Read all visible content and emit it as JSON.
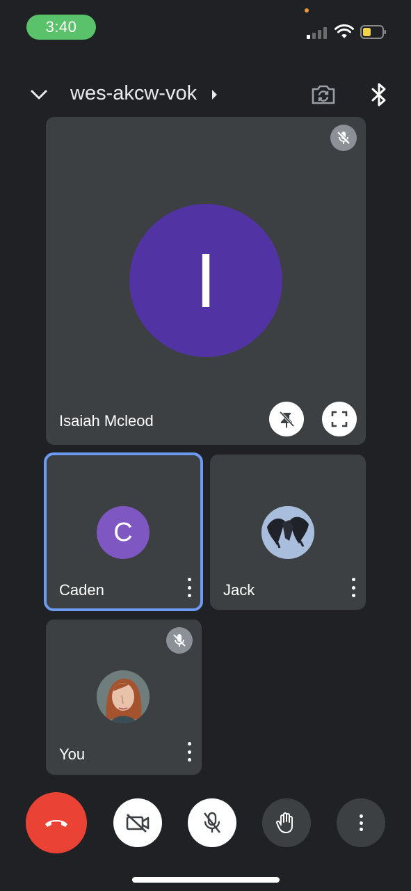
{
  "status_bar": {
    "time": "3:40",
    "signal_bars_active": 1,
    "battery_level_fraction": 0.35,
    "colors": {
      "time_pill": "#5ac26a",
      "battery": "#f3d34a",
      "privacy_dot": "#f0983a"
    }
  },
  "header": {
    "meeting_code": "wes-akcw-vok",
    "icons": [
      "chevron-down-icon",
      "caret-right-icon",
      "switch-camera-icon",
      "bluetooth-icon"
    ]
  },
  "participants": {
    "featured": {
      "name": "Isaiah Mcleod",
      "initial": "I",
      "avatar_color": "#5133a4",
      "muted": true,
      "actions": [
        "unpin-icon",
        "fullscreen-icon"
      ]
    },
    "tiles": [
      {
        "name": "Caden",
        "initial": "C",
        "avatar_color": "#7e57c2",
        "active_speaker": true,
        "muted": false
      },
      {
        "name": "Jack",
        "avatar": "crow-image",
        "muted": false
      },
      {
        "name": "You",
        "avatar": "portrait-image",
        "muted": true
      }
    ]
  },
  "controls": {
    "items": [
      {
        "name": "end-call",
        "icon": "phone-hangup-icon",
        "color": "#ea4335"
      },
      {
        "name": "camera",
        "icon": "video-off-icon"
      },
      {
        "name": "microphone",
        "icon": "mic-off-icon"
      },
      {
        "name": "raise-hand",
        "icon": "hand-icon"
      },
      {
        "name": "more",
        "icon": "more-vert-icon"
      }
    ]
  }
}
